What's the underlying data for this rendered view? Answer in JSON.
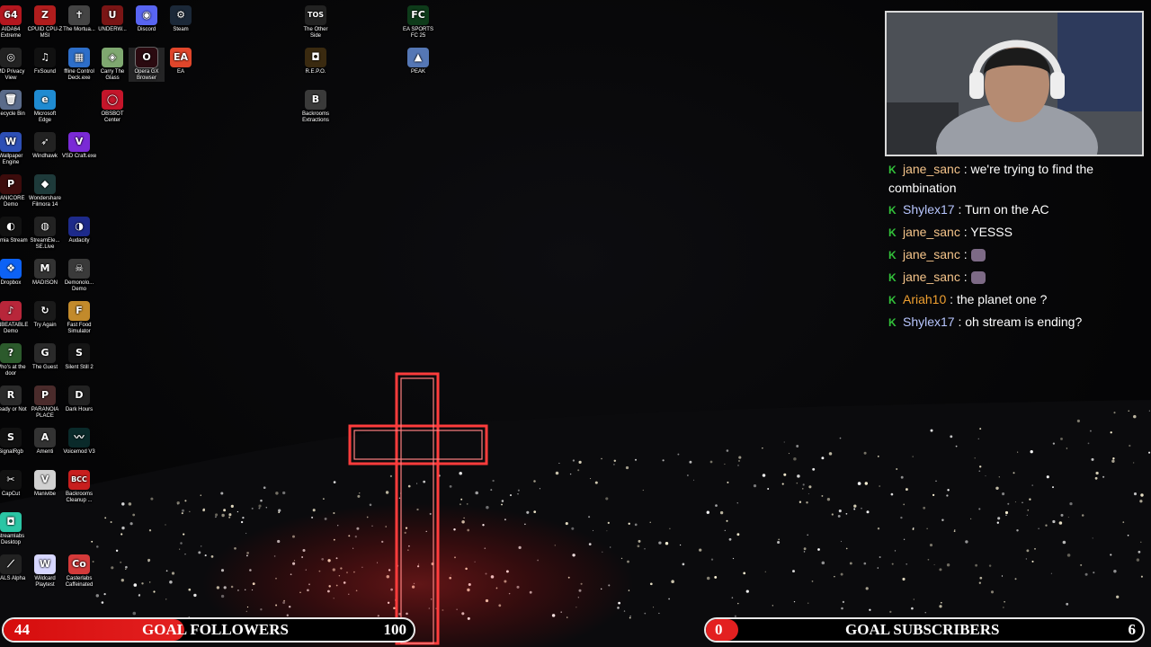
{
  "desktop": {
    "icons": [
      {
        "label": "AIDA64 Extreme",
        "icon": "aida64-icon",
        "color": "#b4171f",
        "glyph": "64"
      },
      {
        "label": "CPUID CPU-Z MSI",
        "icon": "cpuz-icon",
        "color": "#b11d1d",
        "glyph": "Z"
      },
      {
        "label": "The Mortua...",
        "icon": "mortuary-icon",
        "color": "#444",
        "glyph": "✝"
      },
      {
        "label": "UNDERW...",
        "icon": "underw-icon",
        "color": "#7a1515",
        "glyph": "U"
      },
      {
        "label": "Discord",
        "icon": "discord-icon",
        "color": "#5865f2",
        "glyph": "◉"
      },
      {
        "label": "Steam",
        "icon": "steam-icon",
        "color": "#1b2838",
        "glyph": "⚙"
      },
      {
        "label": "MD Privacy View",
        "icon": "privacy-icon",
        "color": "#222",
        "glyph": "◎"
      },
      {
        "label": "FxSound",
        "icon": "fxsound-icon",
        "color": "#111",
        "glyph": "♫"
      },
      {
        "label": "ffline Control Deck.exe",
        "icon": "control-deck-icon",
        "color": "#2d6ec9",
        "glyph": "▦"
      },
      {
        "label": "Carry The Glass",
        "icon": "carry-glass-icon",
        "color": "#7fa870",
        "glyph": "◈"
      },
      {
        "label": "Opera GX Browser",
        "icon": "opera-gx-icon",
        "color": "#2a0a10",
        "glyph": "O"
      },
      {
        "label": "EA",
        "icon": "ea-icon",
        "color": "#e1462b",
        "glyph": "EA"
      },
      {
        "label": "Recycle Bin",
        "icon": "recycle-bin-icon",
        "color": "#5a6b8a",
        "glyph": "🗑"
      },
      {
        "label": "Microsoft Edge",
        "icon": "edge-icon",
        "color": "#1f8bd1",
        "glyph": "e"
      },
      {
        "label": "OBSBOT Center",
        "icon": "obsbot-icon",
        "color": "#c4152a",
        "glyph": "◯"
      },
      {
        "label": "Wallpaper Engine",
        "icon": "wallpaper-engine-icon",
        "color": "#2d4fb5",
        "glyph": "W"
      },
      {
        "label": "Windhawk",
        "icon": "windhawk-icon",
        "color": "#222",
        "glyph": "➶"
      },
      {
        "label": "VSD Craft.exe",
        "icon": "vsd-craft-icon",
        "color": "#7a2ad6",
        "glyph": "V"
      },
      {
        "label": "PANICORE Demo",
        "icon": "panicore-icon",
        "color": "#3c0c0c",
        "glyph": "P"
      },
      {
        "label": "Wondershare Filmora 14",
        "icon": "filmora-icon",
        "color": "#1e3a3a",
        "glyph": "◆"
      },
      {
        "label": "Lumia Stream",
        "icon": "lumia-icon",
        "color": "#111",
        "glyph": "◐"
      },
      {
        "label": "StreamEle... SE.Live",
        "icon": "streamelements-icon",
        "color": "#222",
        "glyph": "◍"
      },
      {
        "label": "Audacity",
        "icon": "audacity-icon",
        "color": "#1d2a8a",
        "glyph": "◑"
      },
      {
        "label": "Dropbox",
        "icon": "dropbox-icon",
        "color": "#0d62f5",
        "glyph": "❖"
      },
      {
        "label": "MADISON",
        "icon": "madison-icon",
        "color": "#333",
        "glyph": "M"
      },
      {
        "label": "Demonolo... Demo",
        "icon": "demonologist-icon",
        "color": "#3a3a3a",
        "glyph": "☠"
      },
      {
        "label": "UNBEATABLE Demo",
        "icon": "unbeatable-icon",
        "color": "#b8263a",
        "glyph": "♪"
      },
      {
        "label": "Try Again",
        "icon": "try-again-icon",
        "color": "#1a1a1a",
        "glyph": "↻"
      },
      {
        "label": "Fast Food Simulator",
        "icon": "fast-food-icon",
        "color": "#c28a2b",
        "glyph": "F"
      },
      {
        "label": "Who's at the door",
        "icon": "whos-at-door-icon",
        "color": "#2c5a2c",
        "glyph": "?"
      },
      {
        "label": "The Guest",
        "icon": "the-guest-icon",
        "color": "#2a2a2a",
        "glyph": "G"
      },
      {
        "label": "Silent Still 2",
        "icon": "silent-still-icon",
        "color": "#151515",
        "glyph": "S"
      },
      {
        "label": "Ready or Not",
        "icon": "ready-or-not-icon",
        "color": "#2a2a2a",
        "glyph": "R"
      },
      {
        "label": "PARANOIA PLACE",
        "icon": "paranoia-icon",
        "color": "#4a2b2b",
        "glyph": "P"
      },
      {
        "label": "Dark Hours",
        "icon": "dark-hours-icon",
        "color": "#222",
        "glyph": "D"
      },
      {
        "label": "SignalRgb",
        "icon": "signalrgb-icon",
        "color": "#111",
        "glyph": "S"
      },
      {
        "label": "Amenti",
        "icon": "amenti-icon",
        "color": "#333",
        "glyph": "A"
      },
      {
        "label": "Voicemod V3",
        "icon": "voicemod-icon",
        "color": "#0a2a2a",
        "glyph": "〰"
      },
      {
        "label": "CapCut",
        "icon": "capcut-icon",
        "color": "#111",
        "glyph": "✂"
      },
      {
        "label": "Manivibe",
        "icon": "manivibe-icon",
        "color": "#d1d1d1",
        "glyph": "V"
      },
      {
        "label": "Backrooms Cleanup ...",
        "icon": "backrooms-cleanup-icon",
        "color": "#c81e1e",
        "glyph": "BCC"
      },
      {
        "label": "Streamlabs Desktop",
        "icon": "streamlabs-icon",
        "color": "#2bc5a4",
        "glyph": "◘"
      },
      {
        "label": "DALS Alpha",
        "icon": "dals-alpha-icon",
        "color": "#222",
        "glyph": "⟋"
      },
      {
        "label": "Wildcard Playtest",
        "icon": "wildcard-icon",
        "color": "#d7d7ff",
        "glyph": "W"
      },
      {
        "label": "Casterlabs Caffeinated",
        "icon": "casterlabs-icon",
        "color": "#d43a3a",
        "glyph": "Co"
      },
      {
        "label": "The Other Side",
        "icon": "other-side-icon",
        "color": "#222",
        "glyph": "TOS"
      },
      {
        "label": "EA SPORTS FC 25",
        "icon": "ea-fc-icon",
        "color": "#0e3b1a",
        "glyph": "FC"
      },
      {
        "label": "R.E.P.O.",
        "icon": "repo-icon",
        "color": "#3a2a10",
        "glyph": "◘"
      },
      {
        "label": "PEAK",
        "icon": "peak-icon",
        "color": "#5577b5",
        "glyph": "▲"
      },
      {
        "label": "Backrooms Extractions",
        "icon": "backrooms-extractions-icon",
        "color": "#3a3a3a",
        "glyph": "B"
      }
    ]
  },
  "chat": {
    "messages": [
      {
        "user": "jane_sanc",
        "user_color": "#f5c48a",
        "text": "we're trying to find the combination",
        "emote": false
      },
      {
        "user": "Shylex17",
        "user_color": "#b8c6ff",
        "text": "Turn on the AC",
        "emote": false
      },
      {
        "user": "jane_sanc",
        "user_color": "#f5c48a",
        "text": "YESSS",
        "emote": false
      },
      {
        "user": "jane_sanc",
        "user_color": "#f5c48a",
        "text": "",
        "emote": true
      },
      {
        "user": "jane_sanc",
        "user_color": "#f5c48a",
        "text": "",
        "emote": true
      },
      {
        "user": "Ariah10",
        "user_color": "#f0a030",
        "text": "the planet one ?",
        "emote": false
      },
      {
        "user": "Shylex17",
        "user_color": "#b8c6ff",
        "text": "oh stream is ending?",
        "emote": false
      }
    ],
    "separator": " : "
  },
  "goals": {
    "followers": {
      "current": "44",
      "label": "GOAL FOLLOWERS",
      "target": "100",
      "fraction": 0.44
    },
    "subscribers": {
      "current": "0",
      "label": "GOAL SUBSCRIBERS",
      "target": "6",
      "fraction": 0.0
    }
  },
  "colors": {
    "accent_red": "#e32020",
    "chat_badge": "#32c13a"
  }
}
